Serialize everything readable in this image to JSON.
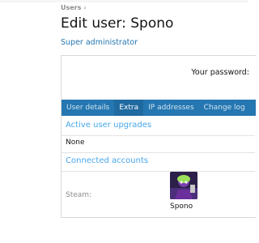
{
  "breadcrumb": {
    "items": [
      "Users"
    ],
    "separator": "›"
  },
  "page_title": "Edit user: Spono",
  "user_role": "Super administrator",
  "password": {
    "label": "Your password:"
  },
  "tabs": [
    {
      "label": "User details",
      "active": false
    },
    {
      "label": "Extra",
      "active": true
    },
    {
      "label": "IP addresses",
      "active": false
    },
    {
      "label": "Change log",
      "active": false
    }
  ],
  "upgrades": {
    "heading": "Active user upgrades",
    "value": "None"
  },
  "connected": {
    "heading": "Connected accounts",
    "accounts": [
      {
        "provider": "Steam:",
        "name": "Spono",
        "avatar_icon": "steam-avatar"
      }
    ]
  },
  "colors": {
    "accent": "#2577b1",
    "section_heading": "#47a7eb",
    "tab_bar": "#2577b1"
  }
}
